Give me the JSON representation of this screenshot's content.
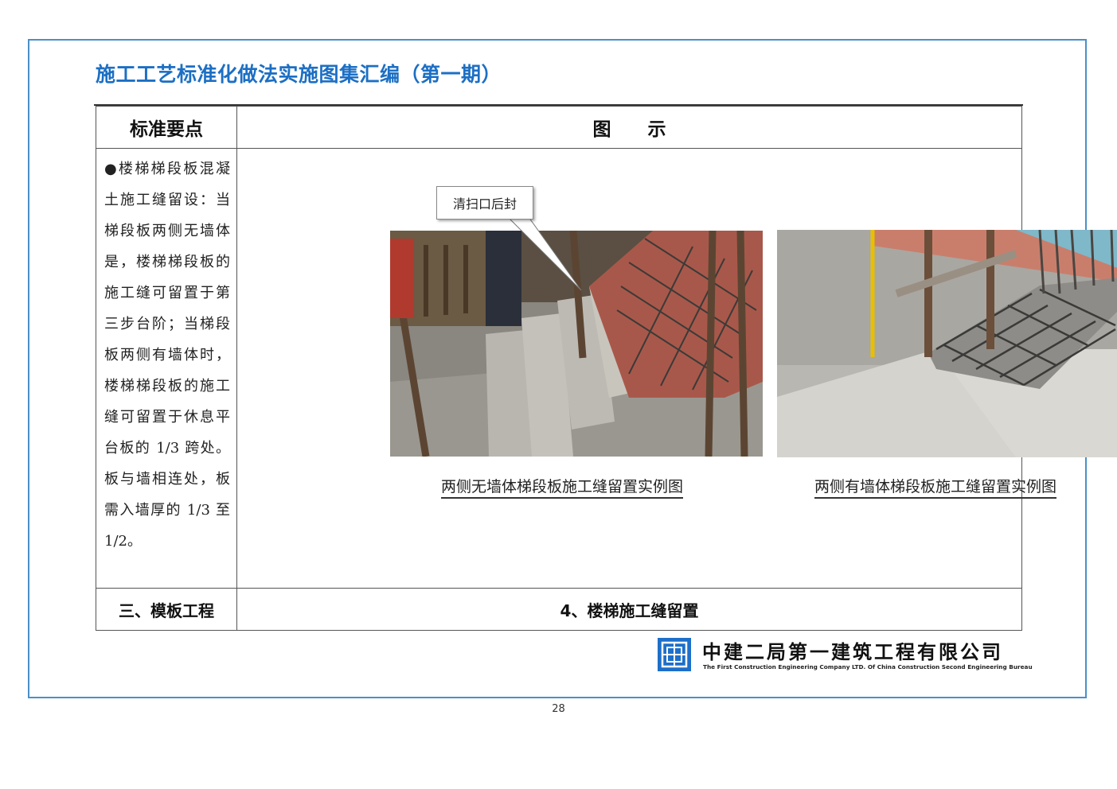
{
  "document": {
    "title": "施工工艺标准化做法实施图集汇编（第一期）",
    "page_number": "28"
  },
  "table": {
    "header_left": "标准要点",
    "header_right": "图　　示",
    "body_text": "●楼梯梯段板混凝土施工缝留设：当梯段板两侧无墙体是，楼梯梯段板的施工缝可留置于第三步台阶；当梯段板两侧有墙体时，楼梯梯段板的施工缝可留置于休息平台板的 1/3 跨处。板与墙相连处，板需入墙厚的 1/3 至 1/2。",
    "footer_left": "三、模板工程",
    "footer_right": "4、楼梯施工缝留置"
  },
  "figures": {
    "callout": "清扫口后封",
    "left_caption": "两侧无墙体梯段板施工缝留置实例图",
    "right_caption": "两侧有墙体梯段板施工缝留置实例图"
  },
  "company": {
    "name_cn": "中建二局第一建筑工程有限公司",
    "name_en": "The First Construction Engineering Company LTD. Of China Construction Second Engineering Bureau",
    "brand_color": "#1d6fc9"
  }
}
